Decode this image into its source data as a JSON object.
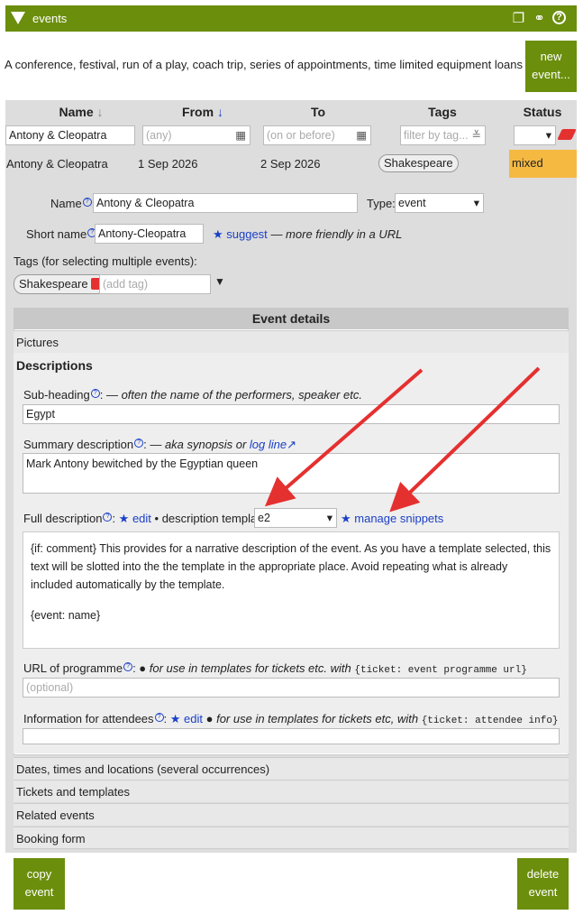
{
  "header": {
    "title": "events"
  },
  "intro": {
    "text": "A conference, festival, run of a play, coach trip, series of appointments, time limited equipment loans etc.",
    "new_event_line1": "new",
    "new_event_line2": "event..."
  },
  "table": {
    "columns": [
      "Name",
      "From",
      "To",
      "Tags",
      "Status"
    ],
    "name_sort_arrow": "↓",
    "from_sort_arrow": "↓",
    "filters": {
      "name_value": "Antony & Cleopatra",
      "from_placeholder": "(any)",
      "to_placeholder": "(on or before)",
      "tags_placeholder": "filter by tag..."
    },
    "row": {
      "name": "Antony & Cleopatra",
      "from": "1 Sep 2026",
      "to": "2 Sep 2026",
      "tag": "Shakespeare",
      "status": "mixed"
    }
  },
  "form": {
    "name_label": "Name",
    "name_value": "Antony & Cleopatra",
    "type_label": "Type:",
    "type_value": "event",
    "short_label": "Short name",
    "short_value": "Antony-Cleopatra",
    "suggest": "★ suggest",
    "suggest_note": "— more friendly in a URL",
    "tags_label": "Tags (for selecting multiple events):",
    "tag": "Shakespeare",
    "add_tag_placeholder": "(add tag)"
  },
  "details": {
    "title": "Event details",
    "pictures": "Pictures",
    "descriptions": "Descriptions",
    "subheading_label": "Sub-heading",
    "subheading_note": "— often the name of the performers, speaker etc.",
    "subheading_value": "Egypt",
    "summary_label": "Summary description",
    "summary_note": "— aka synopsis or",
    "summary_link": "log line",
    "summary_value": "Mark Antony bewitched by the Egyptian queen",
    "full_label": "Full description",
    "full_edit": "★ edit",
    "full_bullet": "• description template",
    "template_value": "e2",
    "manage_snippets": "★ manage snippets",
    "full_text1": "{if: comment} This provides for a narrative description of the event. As you have a template selected, this text will be slotted into the the template in the appropriate place. Avoid repeating what is already included automatically by the template.",
    "full_text2": "{event: name}",
    "programme_label": "URL of programme",
    "programme_note": "● for use in templates for tickets etc. with",
    "programme_code": "{ticket: event programme url}",
    "programme_placeholder": "(optional)",
    "attendees_label": "Information for attendees",
    "attendees_edit": "★ edit",
    "attendees_note": "● for use in templates for tickets etc, with",
    "attendees_code": "{ticket: attendee info}"
  },
  "sections": [
    "Dates, times and locations (several occurrences)",
    "Tickets and templates",
    "Related events",
    "Booking form"
  ],
  "buttons": {
    "copy_line1": "copy",
    "copy_line2": "event",
    "delete_line1": "delete",
    "delete_line2": "event"
  },
  "colors": {
    "olive": "#6b8e0c",
    "status_mixed": "#f5b942",
    "arrow": "#e53030"
  }
}
